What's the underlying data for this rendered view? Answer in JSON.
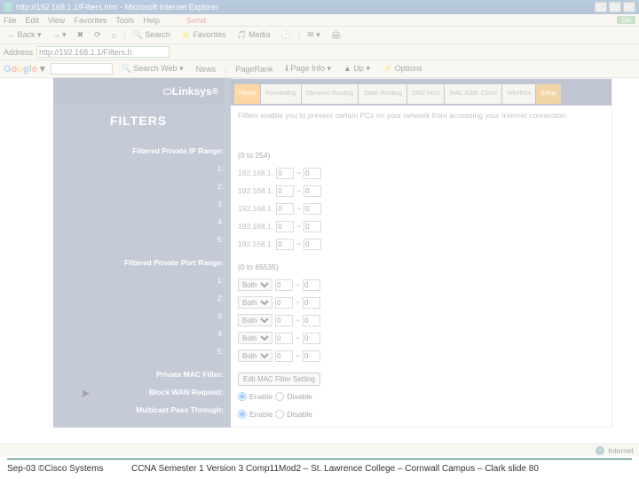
{
  "window": {
    "title": "http://192.168.1.1/Filters.htm - Microsoft Internet Explorer",
    "min": "_",
    "max": "□",
    "close": "×"
  },
  "menubar": {
    "file": "File",
    "edit": "Edit",
    "view": "View",
    "favorites": "Favorites",
    "tools": "Tools",
    "help": "Help",
    "send": "Send",
    "go": "Go"
  },
  "toolbar": {
    "back": "Back",
    "search": "Search",
    "favorites": "Favorites",
    "media": "Media"
  },
  "address": {
    "label": "Address",
    "value": "http://192.168.1.1/Filters.h"
  },
  "google": {
    "search_placeholder": "",
    "search_web": "Search Web",
    "news": "News",
    "pagerank": "PageRank",
    "pageinfo": "Page Info",
    "up": "Up",
    "options": "Options"
  },
  "router": {
    "brand": "Linksys",
    "page_title": "FILTERS",
    "tabs": [
      "Filters",
      "Forwarding",
      "Dynamic Routing",
      "Static Routing",
      "DMZ Host",
      "MAC Addr. Clone",
      "Wireless",
      "Setup"
    ],
    "active_tab": 0,
    "description": "Filters enable you to prevent certain PCs on your network from accessing your Internet connection.",
    "ip_section": {
      "title": "Filtered Private IP Range:",
      "range_hint": "(0 to 254)",
      "rows": [
        {
          "n": "1:",
          "prefix": "192.168.1.",
          "a": "0",
          "b": "0"
        },
        {
          "n": "2:",
          "prefix": "192.168.1.",
          "a": "0",
          "b": "0"
        },
        {
          "n": "3:",
          "prefix": "192.168.1.",
          "a": "0",
          "b": "0"
        },
        {
          "n": "4:",
          "prefix": "192.168.1.",
          "a": "0",
          "b": "0"
        },
        {
          "n": "5:",
          "prefix": "192.168.1.",
          "a": "0",
          "b": "0"
        }
      ]
    },
    "port_section": {
      "title": "Filtered Private Port Range:",
      "range_hint": "(0 to 65535)",
      "rows": [
        {
          "n": "1:",
          "proto": "Both",
          "a": "0",
          "b": "0"
        },
        {
          "n": "2:",
          "proto": "Both",
          "a": "0",
          "b": "0"
        },
        {
          "n": "3:",
          "proto": "Both",
          "a": "0",
          "b": "0"
        },
        {
          "n": "4:",
          "proto": "Both",
          "a": "0",
          "b": "0"
        },
        {
          "n": "5:",
          "proto": "Both",
          "a": "0",
          "b": "0"
        }
      ]
    },
    "mac_filter": {
      "label": "Private MAC Filter:",
      "button": "Edit MAC Filter Setting"
    },
    "block_wan": {
      "label": "Block WAN Request:",
      "enable": "Enable",
      "disable": "Disable"
    },
    "multicast": {
      "label": "Multicast Pass Through:",
      "enable": "Enable",
      "disable": "Disable"
    },
    "tilde": "~"
  },
  "status": {
    "zone": "Internet"
  },
  "footer": {
    "left": "Sep-03 ©Cisco Systems",
    "right": "CCNA Semester 1 Version 3 Comp11Mod2 – St. Lawrence College – Cornwall Campus – Clark slide  80"
  }
}
